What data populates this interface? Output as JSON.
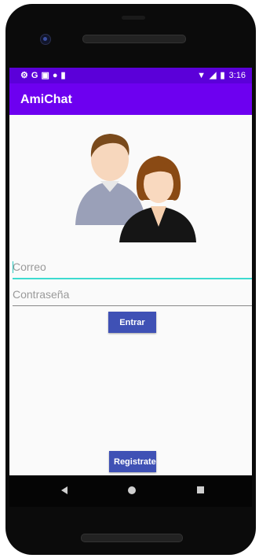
{
  "status_bar": {
    "time": "3:16",
    "left_icons": [
      "gear-icon",
      "g-icon",
      "mail-icon",
      "circle-icon",
      "sd-card-icon"
    ],
    "right_icons": [
      "wifi-icon",
      "signal-icon",
      "battery-icon"
    ]
  },
  "app_bar": {
    "title": "AmiChat"
  },
  "form": {
    "email_placeholder": "Correo",
    "email_value": "",
    "password_placeholder": "Contraseña",
    "password_value": "",
    "login_label": "Entrar",
    "register_label": "Registrate"
  },
  "colors": {
    "status_bar": "#5b00d9",
    "app_bar": "#6d00f0",
    "button": "#3f51b5",
    "focus_underline": "#3ddbd0"
  }
}
